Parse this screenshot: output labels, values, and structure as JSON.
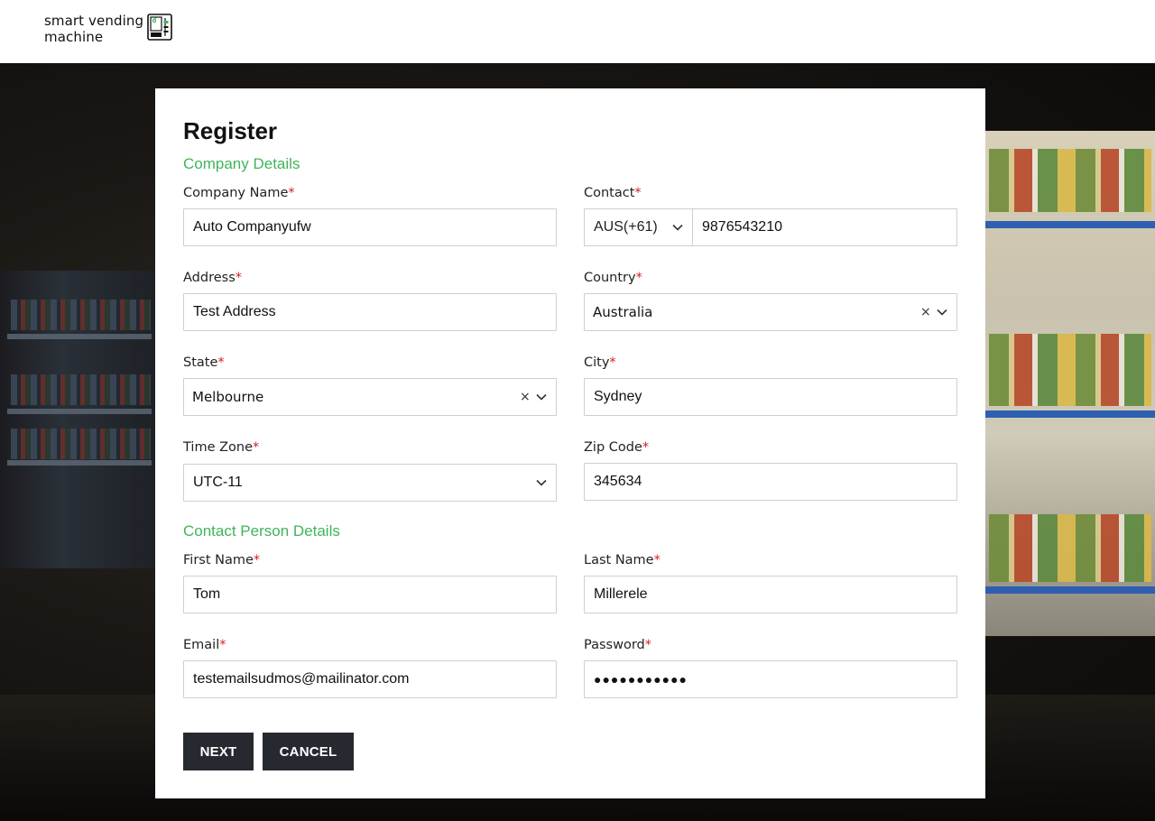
{
  "brand": {
    "line1": "smart vending",
    "line2": "machine",
    "icon": "vending-machine-icon",
    "accent": "#3fb55a"
  },
  "form": {
    "title": "Register",
    "sections": {
      "company": "Company Details",
      "contact_person": "Contact Person Details"
    },
    "company_name": {
      "label": "Company Name",
      "value": "Auto Companyufw"
    },
    "contact": {
      "label": "Contact",
      "code": "AUS(+61)",
      "number": "9876543210"
    },
    "address": {
      "label": "Address",
      "value": "Test Address"
    },
    "country": {
      "label": "Country",
      "value": "Australia"
    },
    "state": {
      "label": "State",
      "value": "Melbourne"
    },
    "city": {
      "label": "City",
      "value": "Sydney"
    },
    "time_zone": {
      "label": "Time Zone",
      "value": "UTC-11"
    },
    "zip_code": {
      "label": "Zip Code",
      "value": "345634"
    },
    "first_name": {
      "label": "First Name",
      "value": "Tom"
    },
    "last_name": {
      "label": "Last Name",
      "value": "Millerele"
    },
    "email": {
      "label": "Email",
      "value": "testemailsudmos@mailinator.com"
    },
    "password": {
      "label": "Password",
      "value": "●●●●●●●●●●●"
    },
    "required_mark": "*",
    "clear_glyph": "×"
  },
  "buttons": {
    "next": "NEXT",
    "cancel": "CANCEL"
  },
  "colors": {
    "required": "#d0202a",
    "button_bg": "#262a30"
  }
}
